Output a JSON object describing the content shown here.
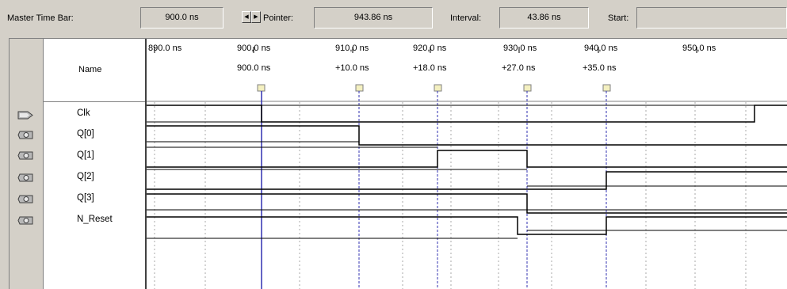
{
  "toolbar": {
    "master_label": "Master Time Bar:",
    "master_value": "900.0 ns",
    "pointer_label": "Pointer:",
    "pointer_value": "943.86 ns",
    "interval_label": "Interval:",
    "interval_value": "43.86 ns",
    "start_label": "Start:",
    "start_value": "",
    "spin_left_icon": "arrow-left-icon",
    "spin_right_icon": "arrow-right-icon"
  },
  "header": {
    "name_label": "Name"
  },
  "ruler": {
    "labels": [
      "890.0 ns",
      "900,0 ns",
      "910,0 ns",
      "920,0 ns",
      "930,0 ns",
      "940,0 ns",
      "950,0 ns"
    ]
  },
  "markers": {
    "labels": [
      "900.0 ns",
      "+10.0 ns",
      "+18.0 ns",
      "+27.0 ns",
      "+35.0 ns"
    ]
  },
  "signals": [
    {
      "name": "Clk",
      "icon": "input-pin-icon"
    },
    {
      "name": "Q[0]",
      "icon": "output-pin-icon"
    },
    {
      "name": "Q[1]",
      "icon": "output-pin-icon"
    },
    {
      "name": "Q[2]",
      "icon": "output-pin-icon"
    },
    {
      "name": "Q[3]",
      "icon": "output-pin-icon"
    },
    {
      "name": "N_Reset",
      "icon": "output-pin-icon"
    }
  ],
  "colors": {
    "background": "#d4d0c8",
    "wave": "#000000",
    "marker_line": "#3030b0",
    "grid": "#a8a8a8",
    "panel": "#ffffff"
  }
}
